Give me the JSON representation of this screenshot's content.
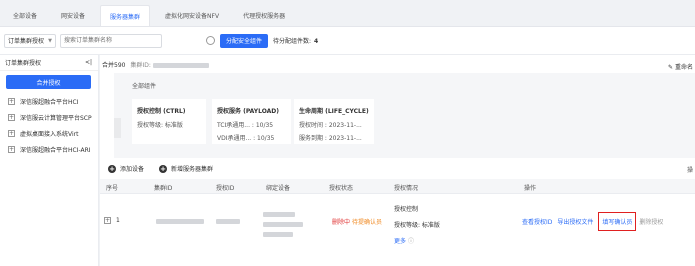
{
  "tabs": [
    "全部设备",
    "网安设备",
    "服务器集群",
    "虚拟化网安设备NFV",
    "代理授权服务器"
  ],
  "toolbar": {
    "filter_select": "订单集群授权",
    "search_placeholder": "搜索订单集群名称",
    "allocate_button": "分配安全组件",
    "pending_label": "待分配组件数:",
    "pending_count": "4"
  },
  "sidebar": {
    "title": "订单集群授权",
    "collapse": "<|",
    "merge_button": "合并授权",
    "items": [
      "深信服超融合平台HCI",
      "深信服云计算管理平台SCP",
      "虚拟桌面接入系统Virt",
      "深信服超融合平台HCI-ARI"
    ]
  },
  "main": {
    "merge_title": "合并590",
    "cluster_id_label": "集群ID:",
    "rename": "重命名",
    "detail_title": "全部组件",
    "cards": [
      {
        "title": "授权控制 (CTRL)",
        "line1": "授权等级: 标准版"
      },
      {
        "title": "授权服务 (PAYLOAD)",
        "line1": "TCI承通用... : 10/35",
        "line2": "VDI承通用... : 10/35"
      },
      {
        "title": "生命周期 (LIFE_CYCLE)",
        "line1": "授权时间 : 2023-11-...",
        "line2": "服务到期 : 2023-11-..."
      }
    ],
    "actions": [
      "添加设备",
      "新增服务器集群"
    ],
    "right_edge": "操",
    "columns": [
      "序号",
      "集群ID",
      "授权ID",
      "绑定设备",
      "授权状态",
      "授权情况",
      "操作"
    ],
    "row": {
      "index": "1",
      "status_part1": "删除中",
      "status_part2": "待提确认员",
      "auth_title": "授权控制",
      "auth_level": "授权等级: 标准版",
      "more": "更多",
      "more_suffix": "ⓘ",
      "op_view": "查看授权ID",
      "op_export": "导出授权文件",
      "op_fill": "填写确认员",
      "op_delete": "删除授权"
    }
  }
}
